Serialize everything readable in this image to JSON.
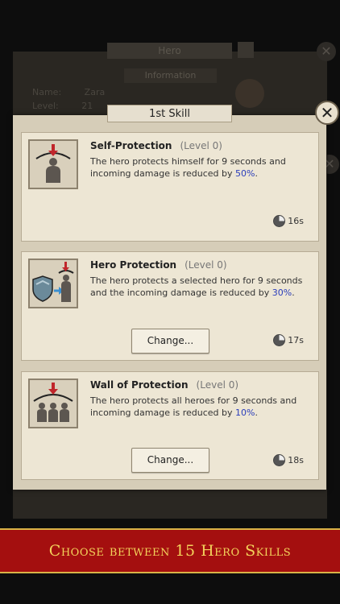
{
  "background": {
    "title": "Hero",
    "subtitle": "Information",
    "name_label": "Name:",
    "name_value": "Zara",
    "level_label": "Level:",
    "level_value": "21"
  },
  "modal": {
    "title": "1st Skill",
    "close_glyph": "✕"
  },
  "skills": [
    {
      "name": "Self-Protection",
      "level": "(Level 0)",
      "desc_before": "The hero protects himself for 9 seconds and incoming damage is reduced by ",
      "percent": "50%",
      "desc_after": ".",
      "cooldown": "16s",
      "icon": "self-protection-icon"
    },
    {
      "name": "Hero Protection",
      "level": "(Level 0)",
      "desc_before": "The hero protects a selected hero for 9 seconds and the incoming damage is reduced by ",
      "percent": "30%",
      "desc_after": ".",
      "cooldown": "17s",
      "button": "Change...",
      "icon": "hero-protection-icon"
    },
    {
      "name": "Wall of Protection",
      "level": "(Level 0)",
      "desc_before": "The hero protects all heroes for 9 seconds and incoming damage is reduced by ",
      "percent": "10%",
      "desc_after": ".",
      "cooldown": "18s",
      "button": "Change...",
      "icon": "wall-of-protection-icon"
    }
  ],
  "banner": {
    "text": "Choose between 15 Hero Skills"
  },
  "colors": {
    "banner_bg": "#a40f0f",
    "banner_text": "#f3d35b",
    "percent_text": "#2a3dbb"
  }
}
